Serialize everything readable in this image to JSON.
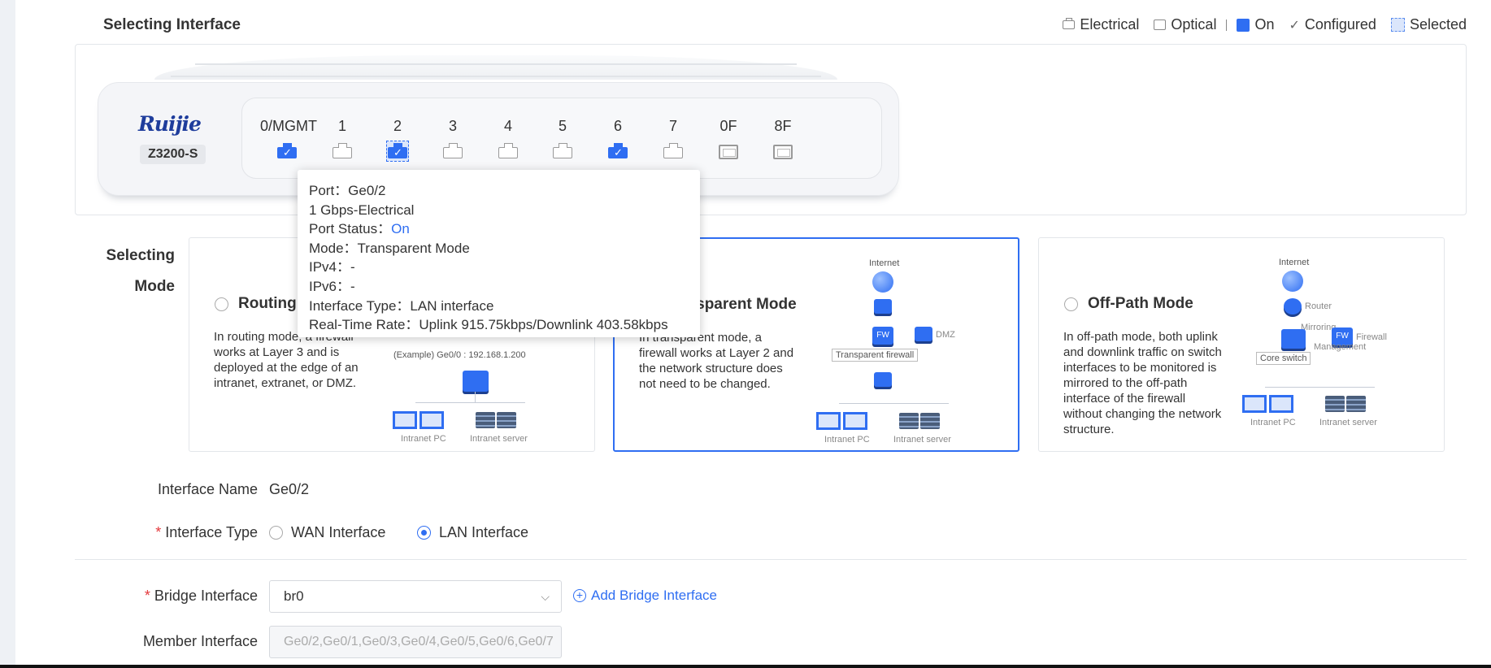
{
  "header": {
    "title": "Selecting Interface"
  },
  "legend": {
    "electrical": "Electrical",
    "optical": "Optical",
    "on": "On",
    "configured": "Configured",
    "selected": "Selected",
    "configured_mark": "✓"
  },
  "device": {
    "brand": "Ruijie",
    "model": "Z3200-S",
    "ports": [
      {
        "label": "0/MGMT",
        "type": "electrical",
        "state": "configured"
      },
      {
        "label": "1",
        "type": "electrical",
        "state": "off"
      },
      {
        "label": "2",
        "type": "electrical",
        "state": "selected"
      },
      {
        "label": "3",
        "type": "electrical",
        "state": "off"
      },
      {
        "label": "4",
        "type": "electrical",
        "state": "off"
      },
      {
        "label": "5",
        "type": "electrical",
        "state": "off"
      },
      {
        "label": "6",
        "type": "electrical",
        "state": "configured"
      },
      {
        "label": "7",
        "type": "electrical",
        "state": "off"
      },
      {
        "label": "0F",
        "type": "optical",
        "state": "off"
      },
      {
        "label": "8F",
        "type": "optical",
        "state": "off"
      }
    ]
  },
  "tooltip": {
    "port": "Port：Ge0/2",
    "speed": "1 Gbps-Electrical",
    "status_label": "Port Status：",
    "status_value": "On",
    "mode": "Mode：Transparent Mode",
    "ipv4": "IPv4：-",
    "ipv6": "IPv6：-",
    "itype": "Interface Type：LAN interface",
    "rate": "Real-Time Rate：Uplink 915.75kbps/Downlink 403.58kbps"
  },
  "mode": {
    "label_line1": "Selecting",
    "label_line2": "Mode",
    "cards": [
      {
        "title": "Routing Mode",
        "desc": "In routing mode, a firewall works at Layer 3 and is deployed at the edge of an intranet, extranet, or DMZ.",
        "selected": false,
        "diagram": {
          "example": "(Example)  Ge0/0 : 192.168.1.200",
          "pc": "Intranet PC",
          "server": "Intranet server"
        }
      },
      {
        "title": "Transparent Mode",
        "desc": "In transparent mode, a firewall works at Layer 2 and the network structure does not need to be changed.",
        "selected": true,
        "diagram": {
          "internet": "Internet",
          "fw": "FW",
          "dmz": "DMZ",
          "tfw": "Transparent firewall",
          "pc": "Intranet PC",
          "server": "Intranet server"
        }
      },
      {
        "title": "Off-Path Mode",
        "desc": "In off-path mode, both uplink and downlink traffic on switch interfaces to be monitored is mirrored to the off-path interface of the firewall without changing the network structure.",
        "selected": false,
        "diagram": {
          "internet": "Internet",
          "router": "Router",
          "mirroring": "Mirroring",
          "firewall": "Firewall",
          "fw": "FW",
          "management": "Management",
          "core": "Core switch",
          "pc": "Intranet PC",
          "server": "Intranet server"
        }
      }
    ]
  },
  "form": {
    "name_label": "Interface Name",
    "name_value": "Ge0/2",
    "type_label": "Interface Type",
    "type_options": [
      "WAN Interface",
      "LAN Interface"
    ],
    "type_selected": "LAN Interface",
    "bridge_label": "Bridge Interface",
    "bridge_value": "br0",
    "add_bridge": "Add Bridge Interface",
    "member_label": "Member Interface",
    "member_value": "Ge0/2,Ge0/1,Ge0/3,Ge0/4,Ge0/5,Ge0/6,Ge0/7",
    "required_mark": "*"
  },
  "colors": {
    "accent": "#2f6ef2",
    "required": "#e4393c"
  }
}
